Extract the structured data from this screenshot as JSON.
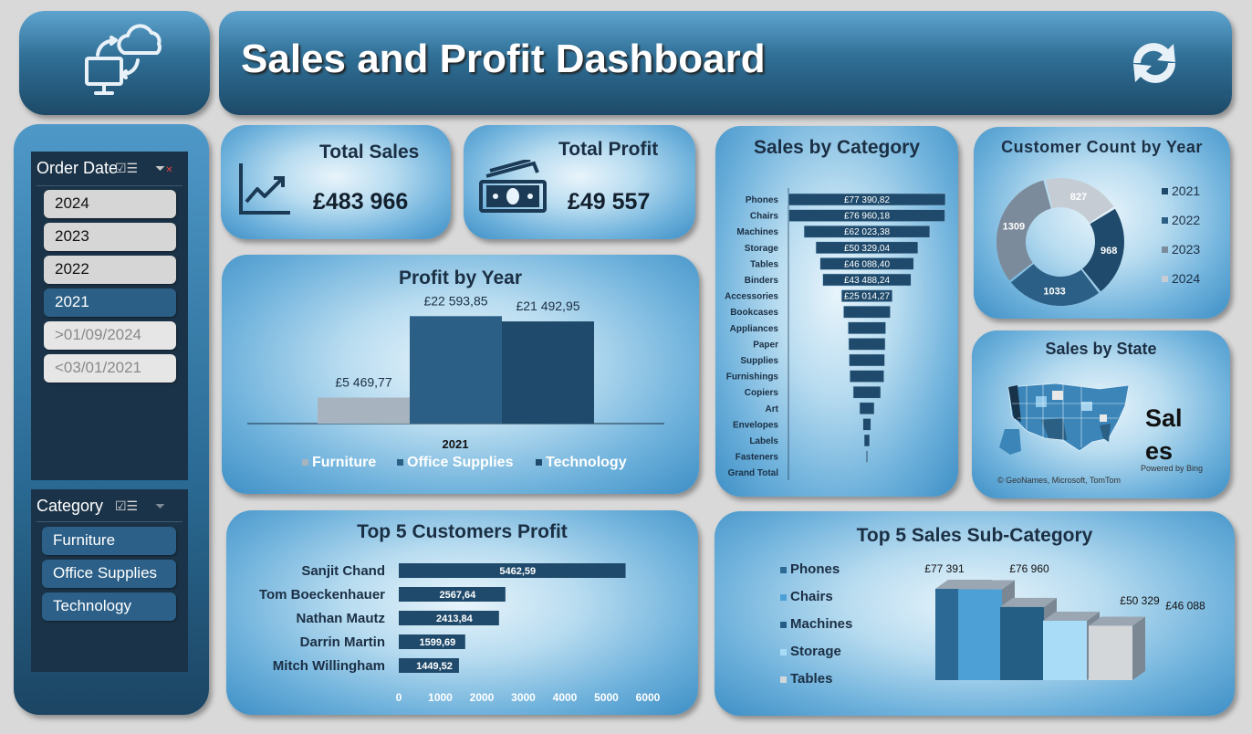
{
  "header": {
    "title": "Sales and Profit Dashboard"
  },
  "slicer_order_date": {
    "title": "Order Date",
    "items": [
      {
        "label": "2024",
        "state": "grey"
      },
      {
        "label": "2023",
        "state": "grey"
      },
      {
        "label": "2022",
        "state": "grey"
      },
      {
        "label": "2021",
        "state": "sel"
      },
      {
        "label": ">01/09/2024",
        "state": "dis"
      },
      {
        "label": "<03/01/2021",
        "state": "dis"
      }
    ]
  },
  "slicer_category": {
    "title": "Category",
    "items": [
      "Furniture",
      "Office Supplies",
      "Technology"
    ]
  },
  "kpi": {
    "sales_label": "Total Sales",
    "sales_value": "£483 966",
    "profit_label": "Total Profit",
    "profit_value": "£49 557"
  },
  "profit_by_year": {
    "title": "Profit by Year"
  },
  "sales_by_category": {
    "title": "Sales by Category"
  },
  "customer_count": {
    "title": "Customer Count by Year"
  },
  "sales_by_state": {
    "title": "Sales by State",
    "credit1": "Powered by Bing",
    "credit2": "© GeoNames, Microsoft, TomTom",
    "big_text1": "Sal",
    "big_text2": "es"
  },
  "top5_customers": {
    "title": "Top 5 Customers Profit"
  },
  "top5_subcat": {
    "title": "Top 5 Sales Sub-Category"
  },
  "chart_data": [
    {
      "type": "bar",
      "title": "Profit by Year",
      "categories": [
        "2021"
      ],
      "series": [
        {
          "name": "Furniture",
          "values": [
            5469.77
          ],
          "label": "£5 469,77",
          "color": "#a7b4c0"
        },
        {
          "name": "Office Supplies",
          "values": [
            22593.85
          ],
          "label": "£22 593,85",
          "color": "#2c5f85"
        },
        {
          "name": "Technology",
          "values": [
            21492.95
          ],
          "label": "£21 492,95",
          "color": "#1f4a6b"
        }
      ]
    },
    {
      "type": "bar",
      "title": "Sales by Category",
      "categories": [
        "Phones",
        "Chairs",
        "Machines",
        "Storage",
        "Tables",
        "Binders",
        "Accessories",
        "Bookcases",
        "Appliances",
        "Paper",
        "Supplies",
        "Furnishings",
        "Copiers",
        "Art",
        "Envelopes",
        "Labels",
        "Fasteners",
        "Grand Total"
      ],
      "values": [
        77390.82,
        76960.18,
        62023.38,
        50329.04,
        46088.4,
        43488.24,
        25014.27,
        23000,
        18500,
        18000,
        17500,
        16800,
        13500,
        7200,
        3900,
        2700,
        700,
        0
      ],
      "labels": [
        "£77 390,82",
        "£76 960,18",
        "£62 023,38",
        "£50 329,04",
        "£46 088,40",
        "£43 488,24",
        "£25 014,27",
        "",
        "",
        "",
        "",
        "",
        "",
        "",
        "",
        "",
        "",
        ""
      ]
    },
    {
      "type": "pie",
      "title": "Customer Count by Year",
      "categories": [
        "2021",
        "2022",
        "2023",
        "2024"
      ],
      "values": [
        968,
        1033,
        1309,
        827
      ],
      "colors": [
        "#1f4a6b",
        "#2c5f85",
        "#7b8b9b",
        "#c5ccd3"
      ]
    },
    {
      "type": "bar",
      "title": "Top 5 Customers Profit",
      "categories": [
        "Sanjit Chand",
        "Tom Boeckenhauer",
        "Nathan Mautz",
        "Darrin Martin",
        "Mitch Willingham"
      ],
      "values": [
        5462.59,
        2567.64,
        2413.84,
        1599.69,
        1449.52
      ],
      "labels": [
        "5462,59",
        "2567,64",
        "2413,84",
        "1599,69",
        "1449,52"
      ],
      "xticks": [
        "0",
        "1000",
        "2000",
        "3000",
        "4000",
        "5000",
        "6000"
      ],
      "xlim": [
        0,
        6000
      ]
    },
    {
      "type": "bar",
      "title": "Top 5 Sales Sub-Category",
      "categories": [
        "Phones",
        "Chairs",
        "Machines",
        "Storage",
        "Tables"
      ],
      "values": [
        77391,
        76960,
        62023,
        50329,
        46088
      ],
      "labels": [
        "£77 391",
        "£76 960",
        "",
        "£50 329",
        "£46 088"
      ],
      "colors": [
        "#2c6a95",
        "#4da0d6",
        "#255e84",
        "#a8dcf7",
        "#d4d7da"
      ]
    }
  ]
}
